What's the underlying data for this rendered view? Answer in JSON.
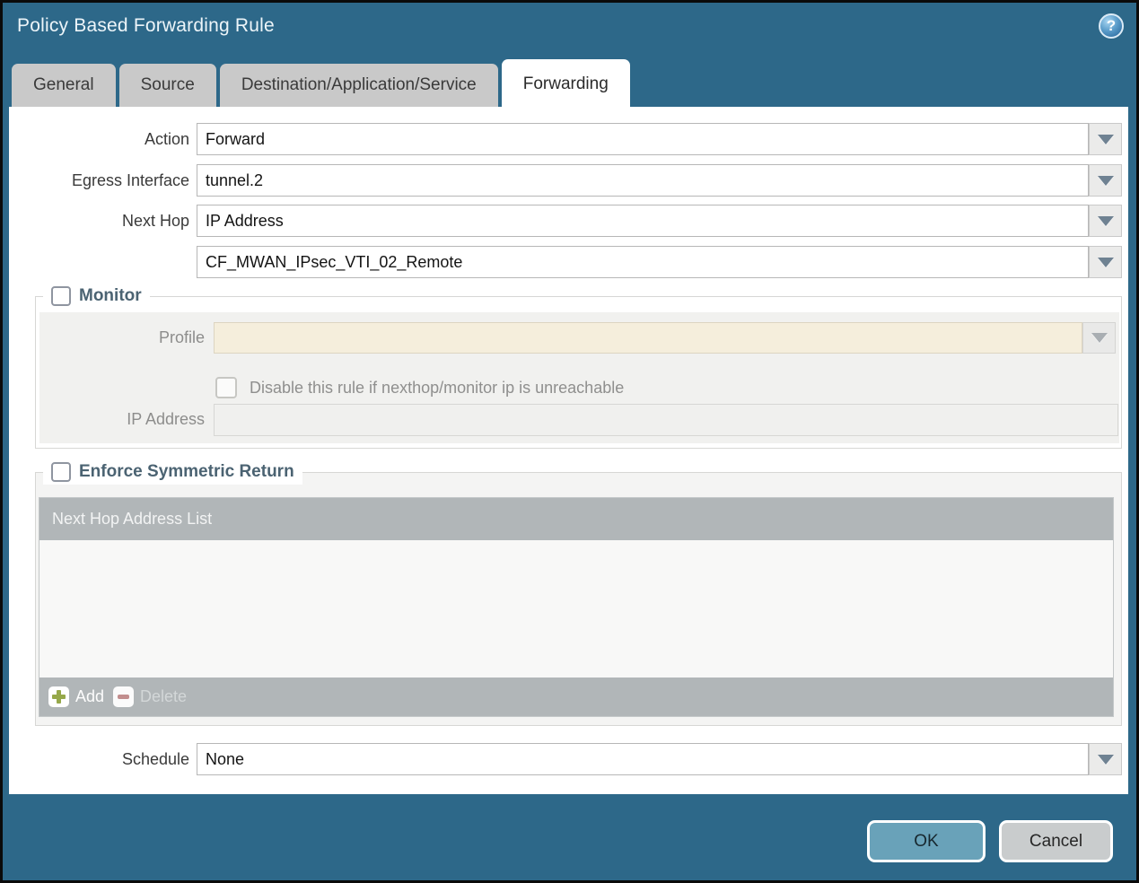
{
  "window": {
    "title": "Policy Based Forwarding Rule"
  },
  "tabs": [
    {
      "label": "General",
      "active": false
    },
    {
      "label": "Source",
      "active": false
    },
    {
      "label": "Destination/Application/Service",
      "active": false
    },
    {
      "label": "Forwarding",
      "active": true
    }
  ],
  "form": {
    "action_label": "Action",
    "action_value": "Forward",
    "egress_label": "Egress Interface",
    "egress_value": "tunnel.2",
    "next_hop_label": "Next Hop",
    "next_hop_value": "IP Address",
    "next_hop_address_value": "CF_MWAN_IPsec_VTI_02_Remote",
    "schedule_label": "Schedule",
    "schedule_value": "None"
  },
  "monitor": {
    "legend": "Monitor",
    "checkbox_checked": false,
    "profile_label": "Profile",
    "profile_value": "",
    "disable_rule_label": "Disable this rule if nexthop/monitor ip is unreachable",
    "disable_rule_checked": false,
    "ip_address_label": "IP Address",
    "ip_address_value": ""
  },
  "symmetric_return": {
    "legend": "Enforce Symmetric Return",
    "checkbox_checked": false,
    "list_header": "Next Hop Address List",
    "rows": [],
    "add_label": "Add",
    "delete_label": "Delete"
  },
  "actions": {
    "ok_label": "OK",
    "cancel_label": "Cancel"
  },
  "colors": {
    "dialog_background": "#2d6889",
    "titlebar_text": "#edf5f9",
    "inactive_tab_bg": "#c9c9c9",
    "active_tab_bg": "#ffffff",
    "profile_field_bg": "#f5eedc",
    "list_header_bg": "#b1b6b8",
    "ok_button_bg": "#69a2b9",
    "cancel_button_bg": "#c9cccd",
    "add_icon_green": "#96a84a",
    "delete_icon_red": "#c28e8e",
    "legend_text": "#4b6372"
  }
}
